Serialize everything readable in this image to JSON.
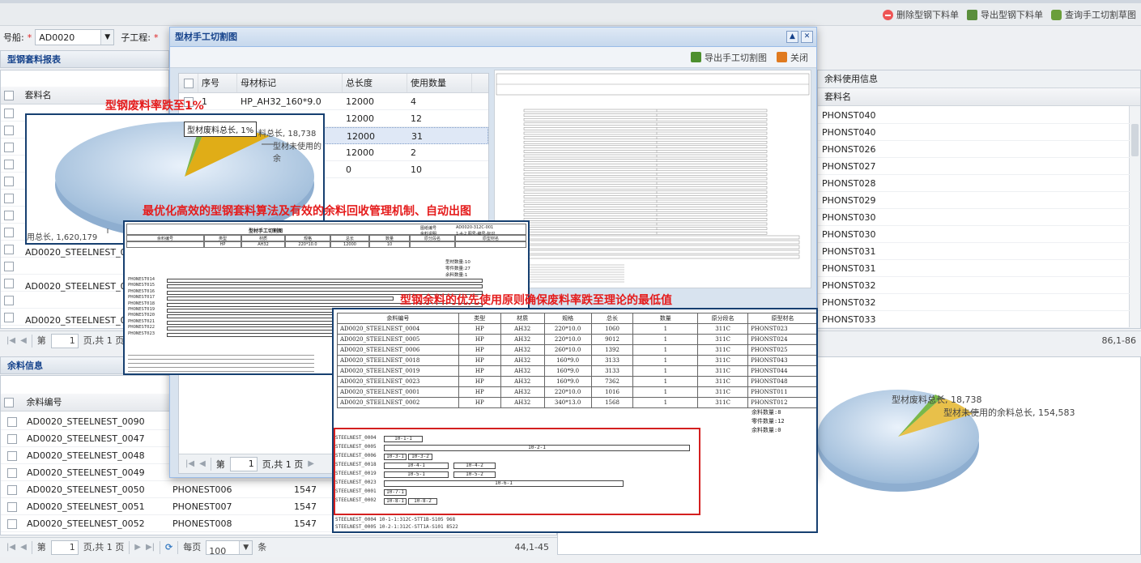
{
  "toolbar": {
    "delete_label": "删除型钢下料单",
    "export_label": "导出型钢下料单",
    "query_label": "查询手工切割草图"
  },
  "filter": {
    "ship_label": "号船:",
    "required_mark": "*",
    "ship_value": "AD0020",
    "sub_label": "子工程:",
    "sub_required": "*"
  },
  "nest_panel": {
    "title": "型钢套料报表",
    "col_name": "套料名",
    "rows": [
      "AD0020_STEELNEST_0012",
      "AD0020_STEELNEST_0013",
      "AD0020_STEELNEST_0014"
    ],
    "page_label_pre": "第",
    "page_value": "1",
    "page_label_post": "页,共 1 页"
  },
  "right_panel": {
    "col_info": "余料使用信息",
    "col_name": "套料名",
    "rows": [
      "PHONST040",
      "PHONST040",
      "PHONST026",
      "PHONST027",
      "PHONST028",
      "PHONST029",
      "PHONST030",
      "PHONST030",
      "PHONST031",
      "PHONST031",
      "PHONST032",
      "PHONST032",
      "PHONST033"
    ],
    "range": "86,1-86"
  },
  "remnant_panel": {
    "title": "余料信息",
    "col_code": "余料编号",
    "rows": [
      {
        "code": "AD0020_STEELNEST_0090",
        "src": "",
        "len": ""
      },
      {
        "code": "AD0020_STEELNEST_0047",
        "src": "",
        "len": ""
      },
      {
        "code": "AD0020_STEELNEST_0048",
        "src": "",
        "len": ""
      },
      {
        "code": "AD0020_STEELNEST_0049",
        "src": "",
        "len": ""
      },
      {
        "code": "AD0020_STEELNEST_0050",
        "src": "PHONEST006",
        "len": "1547"
      },
      {
        "code": "AD0020_STEELNEST_0051",
        "src": "PHONEST007",
        "len": "1547"
      },
      {
        "code": "AD0020_STEELNEST_0052",
        "src": "PHONEST008",
        "len": "1547"
      }
    ],
    "page_label_pre": "第",
    "page_value": "1",
    "page_label_post": "页,共 1 页",
    "per_page_pre": "每页",
    "per_page_value": "100",
    "per_page_post": "条",
    "range": "44,1-45"
  },
  "bottom_pie": {
    "waste_label": "型材废料总长, 18,738",
    "unused_label": "型材未使用的余料总长, 154,583"
  },
  "dialog": {
    "title": "型材手工切割图",
    "export_label": "导出手工切割图",
    "close_label": "关闭",
    "cols": [
      "序号",
      "母材标记",
      "总长度",
      "使用数量"
    ],
    "rows": [
      {
        "no": "1",
        "mark": "HP_AH32_160*9.0",
        "len": "12000",
        "qty": "4"
      },
      {
        "no": "",
        "mark": "",
        "len": "12000",
        "qty": "12"
      },
      {
        "no": "",
        "mark": "",
        "len": "12000",
        "qty": "31"
      },
      {
        "no": "",
        "mark": "",
        "len": "12000",
        "qty": "2"
      },
      {
        "no": "",
        "mark": "",
        "len": "0",
        "qty": "10"
      }
    ],
    "page_label_pre": "第",
    "page_value": "1",
    "page_label_post": "页,共 1 页"
  },
  "overlay_pie": {
    "caption": "型钢废料率跌至1%",
    "tooltip": "型材废料总长, 1%",
    "waste_label": "料总长, 18,738",
    "unused_label": "型材未使用的余",
    "total_label": "用总长, 1,620,179"
  },
  "overlay_drawing": {
    "caption": "最优化高效的型钢套料算法及有效的余料回收管理机制、自动出图",
    "title": "型材手工切割图",
    "meta_label1": "图纸编号",
    "meta_value1": "AD0020-312C-001",
    "meta_label2": "余料说明",
    "meta_value2": "1-4-2 图号-编号-标识",
    "cols": [
      "余料编号",
      "类型",
      "材质",
      "规格",
      "总长",
      "数量",
      "原分段名",
      "原型材名"
    ],
    "row": [
      "",
      "HP",
      "AH32",
      "220*10.0",
      "12000",
      "10",
      "",
      ""
    ],
    "stats": [
      "型材数量:10",
      "零件数量:27",
      "余料数量:1"
    ],
    "parts": [
      "PHONEST014",
      "PHONEST015",
      "PHONEST016",
      "PHONEST017",
      "PHONEST018",
      "PHONEST019",
      "PHONEST020",
      "PHONEST021",
      "PHONEST022",
      "PHONEST023"
    ]
  },
  "overlay_table": {
    "caption": "型钢余料的优先使用原则确保废料率跌至理论的最低值",
    "cols": [
      "余料编号",
      "类型",
      "材质",
      "规格",
      "总长",
      "数量",
      "原分段名",
      "原型材名"
    ],
    "rows": [
      [
        "AD0020_STEELNEST_0004",
        "HP",
        "AH32",
        "220*10.0",
        "1060",
        "1",
        "311C",
        "PHONST023"
      ],
      [
        "AD0020_STEELNEST_0005",
        "HP",
        "AH32",
        "220*10.0",
        "9012",
        "1",
        "311C",
        "PHONST024"
      ],
      [
        "AD0020_STEELNEST_0006",
        "HP",
        "AH32",
        "260*10.0",
        "1392",
        "1",
        "311C",
        "PHONST025"
      ],
      [
        "AD0020_STEELNEST_0018",
        "HP",
        "AH32",
        "160*9.0",
        "3133",
        "1",
        "311C",
        "PHONST043"
      ],
      [
        "AD0020_STEELNEST_0019",
        "HP",
        "AH32",
        "160*9.0",
        "3133",
        "1",
        "311C",
        "PHONST044"
      ],
      [
        "AD0020_STEELNEST_0023",
        "HP",
        "AH32",
        "160*9.0",
        "7362",
        "1",
        "311C",
        "PHONST048"
      ],
      [
        "AD0020_STEELNEST_0001",
        "HP",
        "AH32",
        "220*10.0",
        "1016",
        "1",
        "311C",
        "PHONST011"
      ],
      [
        "AD0020_STEELNEST_0002",
        "HP",
        "AH32",
        "340*13.0",
        "1568",
        "1",
        "311C",
        "PHONST012"
      ]
    ],
    "stats": [
      "余料数量:8",
      "零件数量:12",
      "余料数量:0"
    ],
    "nests": [
      {
        "name": "STEELNEST_0004",
        "segs": [
          "10-1-1"
        ]
      },
      {
        "name": "STEELNEST_0005",
        "segs": [
          "10-2-1"
        ]
      },
      {
        "name": "STEELNEST_0006",
        "segs": [
          "10-3-1",
          "10-3-2"
        ]
      },
      {
        "name": "STEELNEST_0018",
        "segs": [
          "10-4-1",
          "10-4-2"
        ]
      },
      {
        "name": "STEELNEST_0019",
        "segs": [
          "10-5-1",
          "10-5-2"
        ]
      },
      {
        "name": "STEELNEST_0023",
        "segs": [
          "10-6-1"
        ]
      },
      {
        "name": "STEELNEST_0001",
        "segs": [
          "10-7-1"
        ]
      },
      {
        "name": "STEELNEST_0002",
        "segs": [
          "10-8-1",
          "10-8-2"
        ]
      }
    ],
    "footer1": "STEELNEST_0004 10-1-1:312C-STT1B-S105 968",
    "footer2": "STEELNEST_0005 10-2-1:312C-STT1A-S101 8522"
  }
}
